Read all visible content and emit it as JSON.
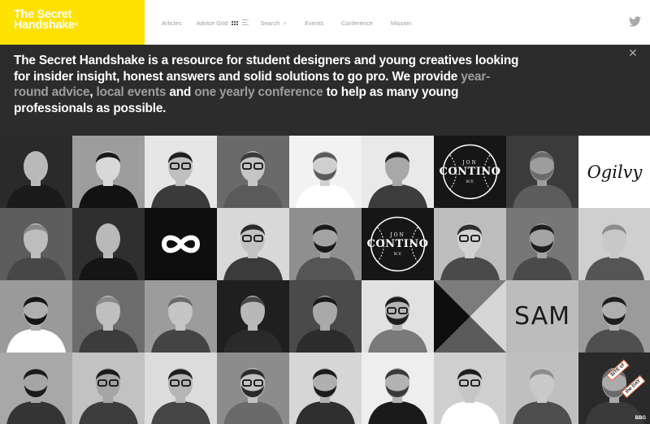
{
  "brand": {
    "logo_line1": "The Secret",
    "logo_line2": "Handshake",
    "logo_mark": "®",
    "yellow": "#ffe100"
  },
  "nav": {
    "articles": "Articles",
    "advice_grid": "Advice Grid",
    "search": "Search",
    "events": "Events",
    "conference": "Conference",
    "mission": "Mission",
    "icons": [
      "grid-view-icon",
      "list-view-icon",
      "search-icon",
      "twitter-icon"
    ]
  },
  "intro": {
    "part1": "The Secret Handshake is a resource for student designers and young creatives looking for insider insight, honest answers and solid solutions to go pro. We provide ",
    "link1": "year-round advice",
    "sep1": ", ",
    "link2": "local events",
    "sep2": " and ",
    "link3": "one yearly conference",
    "part2": " to help as many young professionals as possible.",
    "link_color": "#9d9d9d",
    "close_icon": "close-icon"
  },
  "tiles": {
    "ogilvy_text": "Ogilvy",
    "sam_text": "SAM",
    "contino_small": "JON",
    "contino_big": "CONTINO",
    "contino_ny": "N.Y.",
    "badge_site": "SITE of",
    "badge_day": "the DAY",
    "badge_bbg": "BBG"
  }
}
